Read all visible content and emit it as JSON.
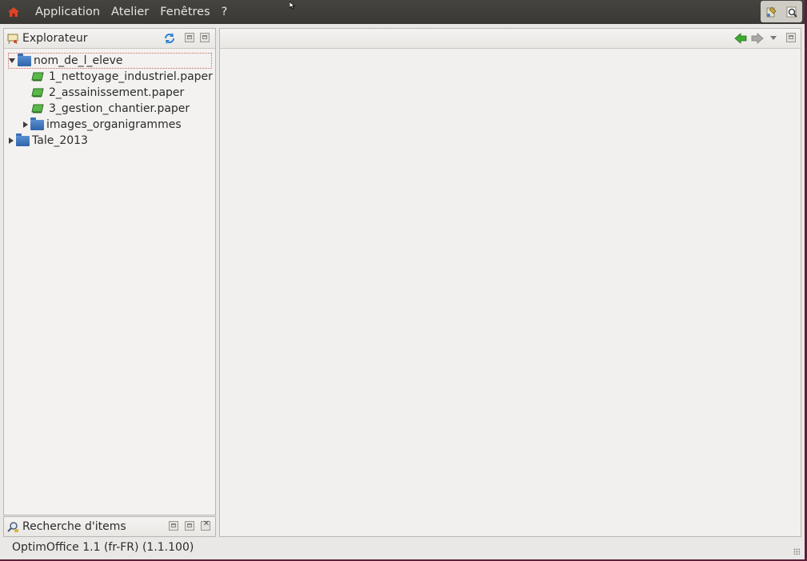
{
  "menubar": {
    "items": [
      "Application",
      "Atelier",
      "Fenêtres",
      "?"
    ]
  },
  "explorer": {
    "title": "Explorateur",
    "tree": [
      {
        "label": "nom_de_l_eleve",
        "type": "folder",
        "expanded": true,
        "level": 0,
        "selected": true
      },
      {
        "label": "1_nettoyage_industriel.paper",
        "type": "paper",
        "level": 1
      },
      {
        "label": "2_assainissement.paper",
        "type": "paper",
        "level": 1
      },
      {
        "label": "3_gestion_chantier.paper",
        "type": "paper",
        "level": 1
      },
      {
        "label": "images_organigrammes",
        "type": "folder",
        "expanded": false,
        "level": 1
      },
      {
        "label": "Tale_2013",
        "type": "folder",
        "expanded": false,
        "level": 0
      }
    ]
  },
  "search_panel": {
    "title": "Recherche d'items"
  },
  "status_bar": {
    "text": "OptimOffice 1.1 (fr-FR) (1.1.100)"
  },
  "colors": {
    "menubar": "#3f3e3a",
    "accent_green": "#3cab2f",
    "folder_blue": "#3a6fb4",
    "selection_border": "#d0645e"
  }
}
